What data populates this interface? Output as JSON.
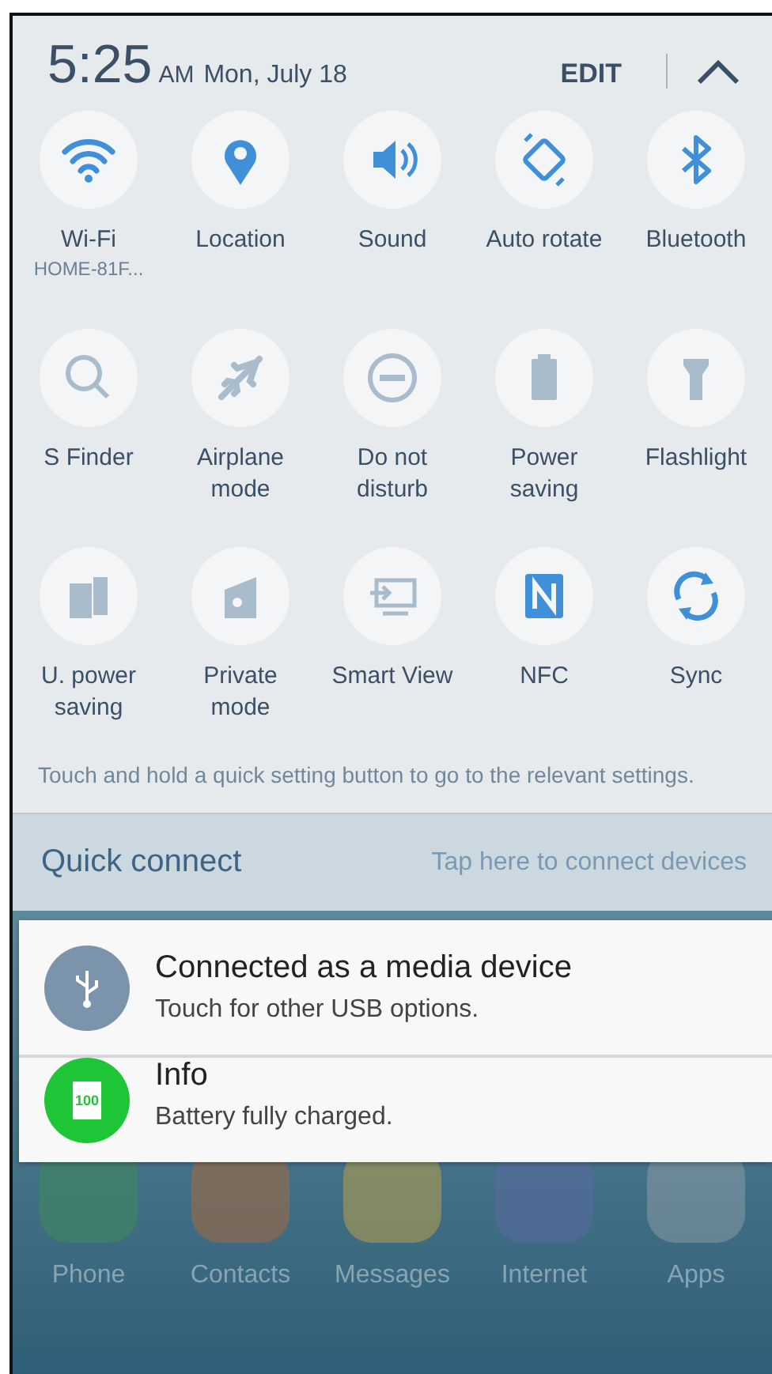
{
  "header": {
    "time": "5:25",
    "ampm": "AM",
    "date": "Mon, July 18",
    "edit": "EDIT"
  },
  "tiles": [
    {
      "label": "Wi-Fi",
      "sublabel": "HOME-81F...",
      "on": true
    },
    {
      "label": "Location",
      "on": true
    },
    {
      "label": "Sound",
      "on": true
    },
    {
      "label": "Auto rotate",
      "on": true
    },
    {
      "label": "Bluetooth",
      "on": true
    },
    {
      "label": "S Finder",
      "on": false
    },
    {
      "label": "Airplane mode",
      "on": false
    },
    {
      "label": "Do not disturb",
      "on": false
    },
    {
      "label": "Power saving",
      "on": false
    },
    {
      "label": "Flashlight",
      "on": false
    },
    {
      "label": "U. power saving",
      "on": false
    },
    {
      "label": "Private mode",
      "on": false
    },
    {
      "label": "Smart View",
      "on": false
    },
    {
      "label": "NFC",
      "on": true
    },
    {
      "label": "Sync",
      "on": true
    }
  ],
  "hint": "Touch and hold a quick setting button to go to the relevant settings.",
  "quick_connect": {
    "title": "Quick connect",
    "action": "Tap here to connect devices"
  },
  "notifications": [
    {
      "title": "Connected as a media device",
      "text": "Touch for other USB options.",
      "color": "#7b93ab"
    },
    {
      "title": "Info",
      "text": "Battery fully charged.",
      "color": "#1ec637",
      "battery": "100"
    }
  ],
  "dock": [
    "Phone",
    "Contacts",
    "Messages",
    "Internet",
    "Apps"
  ]
}
